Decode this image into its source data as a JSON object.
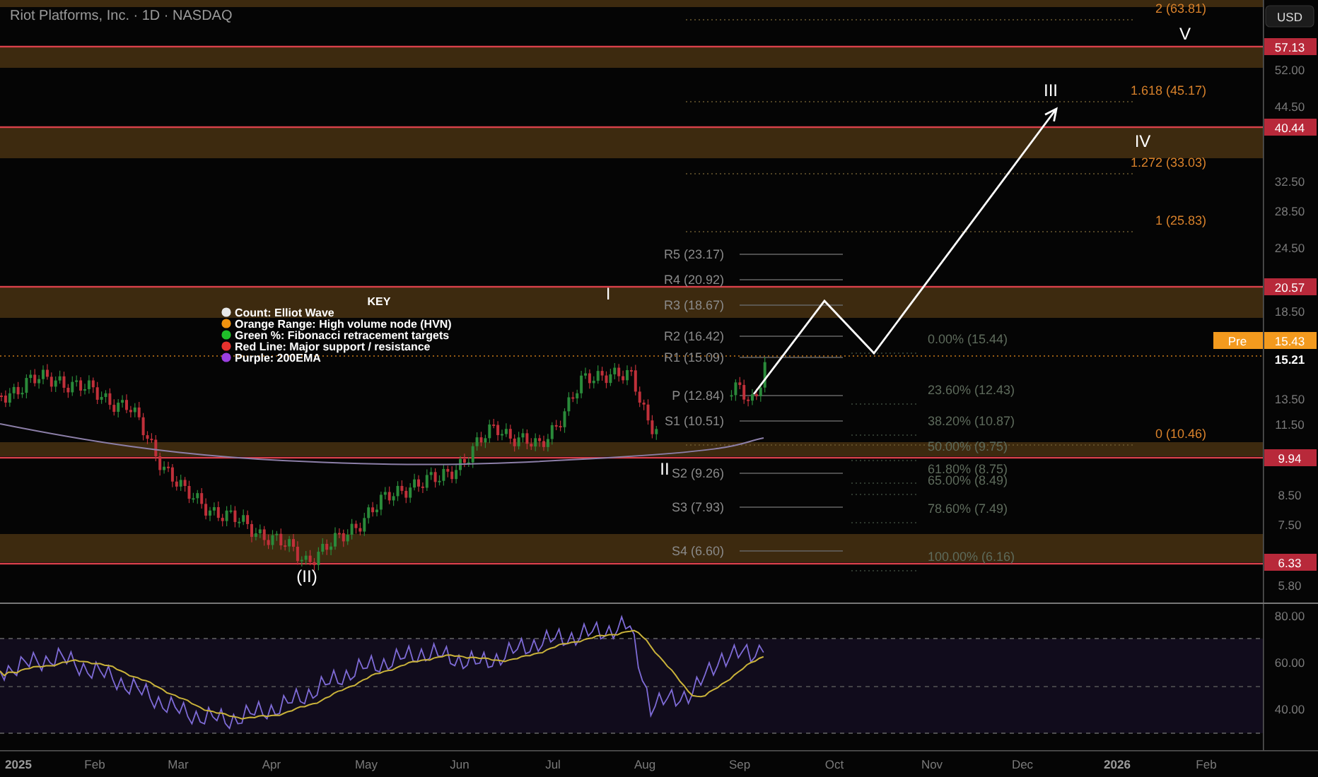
{
  "chart": {
    "title": "Riot Platforms, Inc. · 1D · NASDAQ"
  },
  "currency_button": {
    "label": "USD"
  },
  "legend": {
    "title": "KEY",
    "items": [
      {
        "label": "Count: Elliot Wave",
        "color": "#e8e8e8"
      },
      {
        "label": "Orange Range: High volume node (HVN)",
        "color": "#f0920f"
      },
      {
        "label": "Green %: Fibonacci retracement targets",
        "color": "#1fbf2a"
      },
      {
        "label": "Red Line: Major support / resistance",
        "color": "#e8322e"
      },
      {
        "label": "Purple: 200EMA",
        "color": "#9b3fe0"
      }
    ]
  },
  "wave_labels": [
    "I",
    "II",
    "III",
    "IV",
    "V",
    "(II)"
  ],
  "pivot_labels": [
    "R5 (23.17)",
    "R4 (20.92)",
    "R3 (18.67)",
    "R2 (16.42)",
    "R1 (15.09)",
    "P (12.84)",
    "S1 (10.51)",
    "S2 (9.26)",
    "S3 (7.93)",
    "S4 (6.60)"
  ],
  "fib_retracement_labels": [
    "0.00% (15.44)",
    "23.60% (12.43)",
    "38.20% (10.87)",
    "50.00% (9.75)",
    "61.80% (8.75)",
    "65.00% (8.49)",
    "78.60% (7.49)",
    "100.00% (6.16)"
  ],
  "fib_extension_labels": [
    "2 (63.81)",
    "1.618 (45.17)",
    "1.272 (33.03)",
    "1 (25.83)",
    "0 (10.46)"
  ],
  "price_axis": {
    "premarket_badge": "Pre",
    "labels": [
      {
        "text": "57.13",
        "kind": "line"
      },
      {
        "text": "52.00",
        "kind": "tick"
      },
      {
        "text": "44.50",
        "kind": "tick"
      },
      {
        "text": "40.44",
        "kind": "line"
      },
      {
        "text": "32.50",
        "kind": "tick"
      },
      {
        "text": "28.50",
        "kind": "tick"
      },
      {
        "text": "24.50",
        "kind": "tick"
      },
      {
        "text": "20.57",
        "kind": "line"
      },
      {
        "text": "18.50",
        "kind": "tick"
      },
      {
        "text": "15.43",
        "kind": "pre"
      },
      {
        "text": "15.21",
        "kind": "last"
      },
      {
        "text": "13.50",
        "kind": "tick"
      },
      {
        "text": "11.50",
        "kind": "tick"
      },
      {
        "text": "9.94",
        "kind": "line"
      },
      {
        "text": "8.50",
        "kind": "tick"
      },
      {
        "text": "7.50",
        "kind": "tick"
      },
      {
        "text": "6.33",
        "kind": "line"
      },
      {
        "text": "5.80",
        "kind": "tick"
      }
    ]
  },
  "rsi_axis": [
    "80.00",
    "60.00",
    "40.00"
  ],
  "time_axis": [
    {
      "text": "2025",
      "kind": "year"
    },
    {
      "text": "Feb",
      "kind": "month"
    },
    {
      "text": "Mar",
      "kind": "month"
    },
    {
      "text": "Apr",
      "kind": "month"
    },
    {
      "text": "May",
      "kind": "month"
    },
    {
      "text": "Jun",
      "kind": "month"
    },
    {
      "text": "Jul",
      "kind": "month"
    },
    {
      "text": "Aug",
      "kind": "month"
    },
    {
      "text": "Sep",
      "kind": "month"
    },
    {
      "text": "Oct",
      "kind": "month"
    },
    {
      "text": "Nov",
      "kind": "month"
    },
    {
      "text": "Dec",
      "kind": "month"
    },
    {
      "text": "2026",
      "kind": "year"
    },
    {
      "text": "Feb",
      "kind": "month"
    }
  ]
}
